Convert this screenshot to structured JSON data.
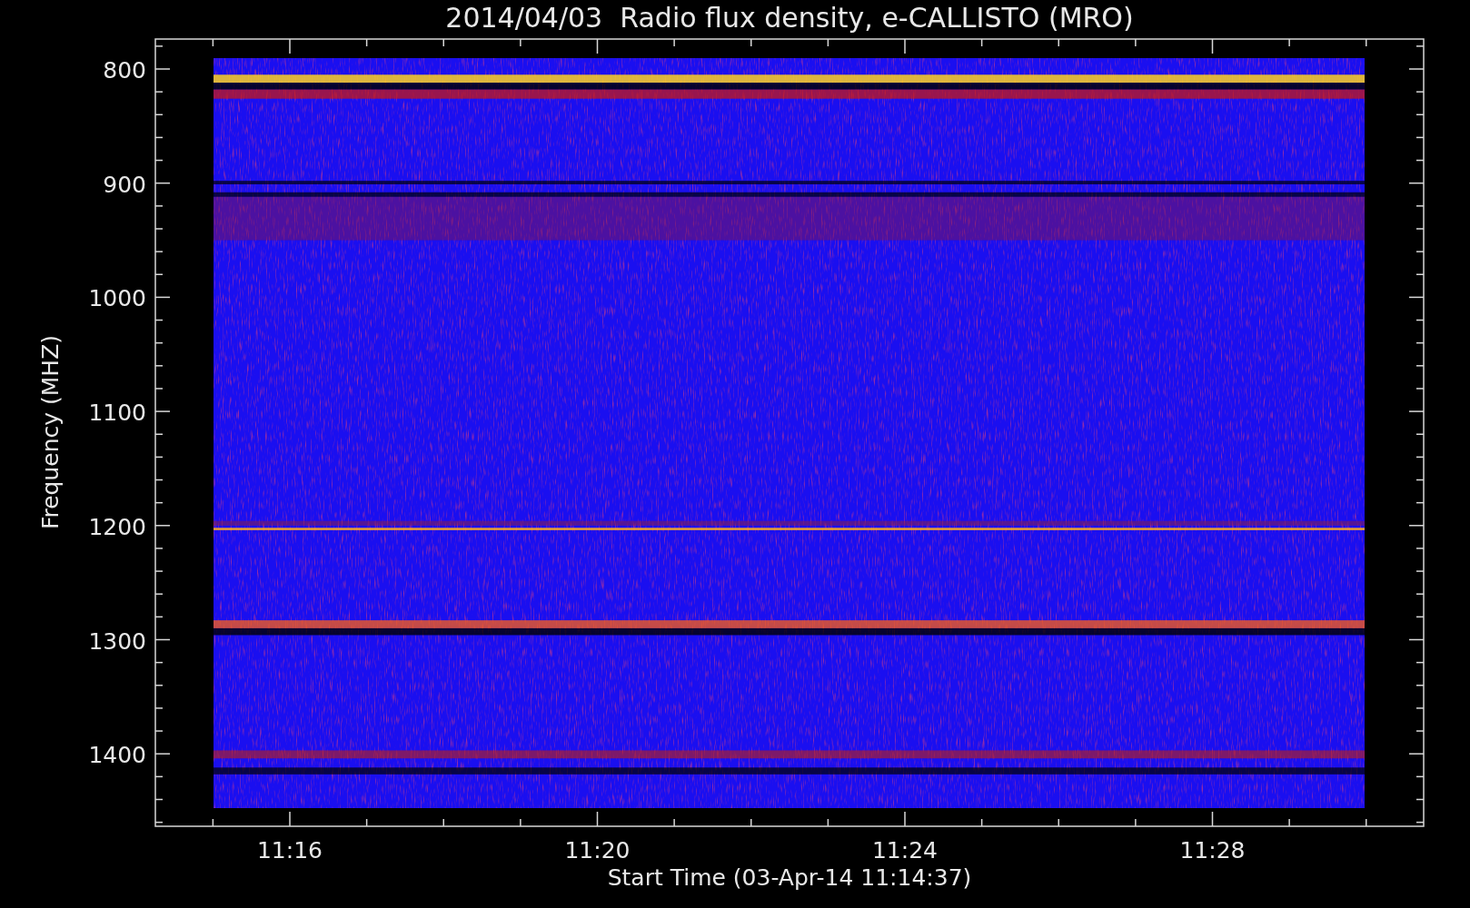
{
  "title": "2014/04/03  Radio flux density, e-CALLISTO (MRO)",
  "y_axis": {
    "label": "Frequency (MHZ)",
    "ticks": [
      "800",
      "900",
      "1000",
      "1100",
      "1200",
      "1300",
      "1400"
    ]
  },
  "x_axis": {
    "label": "Start Time (03-Apr-14 11:14:37)",
    "ticks": [
      "11:16",
      "11:20",
      "11:24",
      "11:28"
    ]
  }
}
